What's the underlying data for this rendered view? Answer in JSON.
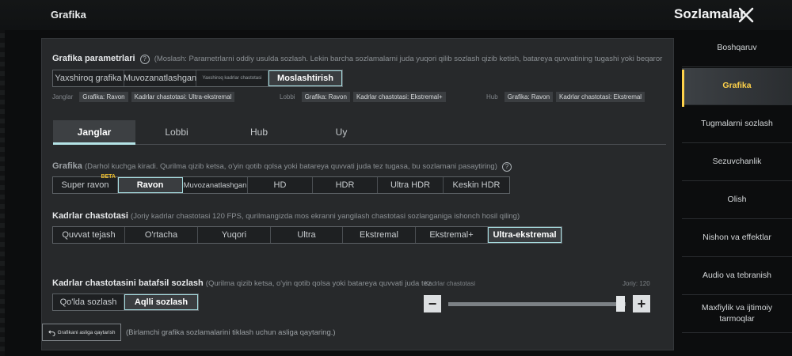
{
  "header": {
    "section_title": "Grafika",
    "settings_title": "Sozlamalar"
  },
  "preset": {
    "title": "Grafika parametrlari",
    "hint": "(Moslash: Parametrlarni oddiy usulda sozlash. Lekin barcha sozlamalarni juda yuqori qilib sozlash qizib ketish, batareya quvvatining tugashi yoki beqaror",
    "options": [
      "Yaxshiroq grafika",
      "Muvozanatlashgan",
      "Yaxshiroq kadrlar chastotasi",
      "Moslashtirish"
    ],
    "active_index": 3,
    "summaries": [
      {
        "label": "Janglar",
        "graphics": "Grafika: Ravon",
        "fps": "Kadrlar chastotasi: Ultra-ekstremal"
      },
      {
        "label": "Lobbi",
        "graphics": "Grafika: Ravon",
        "fps": "Kadrlar chastotasi: Ekstremal+"
      },
      {
        "label": "Hub",
        "graphics": "Grafika: Ravon",
        "fps": "Kadrlar chastotasi: Ekstremal"
      }
    ]
  },
  "tabs": {
    "items": [
      "Janglar",
      "Lobbi",
      "Hub",
      "Uy"
    ],
    "active_index": 0
  },
  "graphics": {
    "title": "Grafika",
    "hint": "(Darhol kuchga kiradi. Qurilma qizib ketsa, o'yin qotib qolsa yoki batareya quvvati juda tez tugasa, bu sozlamani pasaytiring)",
    "options": [
      "Super ravon",
      "Ravon",
      "Muvozanatlashgan",
      "HD",
      "HDR",
      "Ultra HDR",
      "Keskin HDR"
    ],
    "beta_label": "BETA",
    "active_index": 1
  },
  "framerate": {
    "title": "Kadrlar chastotasi",
    "hint": "(Joriy kadrlar chastotasi 120 FPS, qurilmangizda mos ekranni yangilash chastotasi sozlanganiga ishonch hosil qiling)",
    "options": [
      "Quvvat tejash",
      "O'rtacha",
      "Yuqori",
      "Ultra",
      "Ekstremal",
      "Ekstremal+",
      "Ultra-ekstremal"
    ],
    "active_index": 6
  },
  "fine_tune": {
    "title": "Kadrlar chastotasini batafsil sozlash",
    "hint": "(Qurilma qizib ketsa, o'yin qotib qolsa yoki batareya quvvati juda tez",
    "options": [
      "Qo'lda sozlash",
      "Aqlli sozlash"
    ],
    "active_index": 1,
    "slider_label": "Kadrlar chastotasi",
    "slider_value": "Joriy: 120",
    "slider_fraction": 0.97,
    "minus": "−",
    "plus": "+"
  },
  "reset": {
    "button_label": "Grafikani asliga qaytarish",
    "hint": "(Birlamchi grafika sozlamalarini tiklash uchun asliga qaytaring.)"
  },
  "sidebar": {
    "items": [
      "Boshqaruv",
      "Grafika",
      "Tugmalarni sozlash",
      "Sezuvchanlik",
      "Olish",
      "Nishon va effektlar",
      "Audio va tebranish",
      "Maxfiylik va ijtimoiy tarmoqlar"
    ],
    "active_index": 1
  },
  "colors": {
    "accent": "#ffd24a",
    "active_outline": "#a6dde0",
    "beta": "#f0c030"
  }
}
